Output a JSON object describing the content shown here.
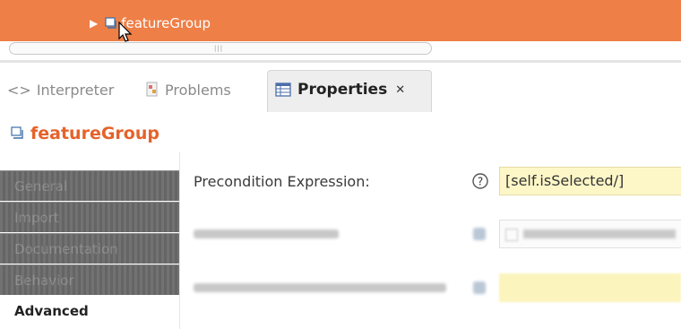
{
  "tree": {
    "expand_arrow": "▶",
    "node_label": "featureGroup"
  },
  "tabs": {
    "interpreter": {
      "icon": "code-brackets-icon",
      "label": "Interpreter"
    },
    "problems": {
      "icon": "problems-icon",
      "label": "Problems"
    },
    "properties": {
      "icon": "properties-table-icon",
      "label": "Properties",
      "close_glyph": "✕"
    }
  },
  "properties_title": "featureGroup",
  "property_tabs": [
    {
      "label": "General",
      "active": false
    },
    {
      "label": "Import",
      "active": false
    },
    {
      "label": "Documentation",
      "active": false
    },
    {
      "label": "Behavior",
      "active": false
    },
    {
      "label": "Advanced",
      "active": true
    }
  ],
  "form": {
    "precondition_label": "Precondition Expression:",
    "precondition_value": "[self.isSelected/]",
    "help_glyph": "?"
  },
  "colors": {
    "accent": "#ee7f47",
    "title": "#e5622a",
    "field_bg": "#fdf7c8"
  }
}
